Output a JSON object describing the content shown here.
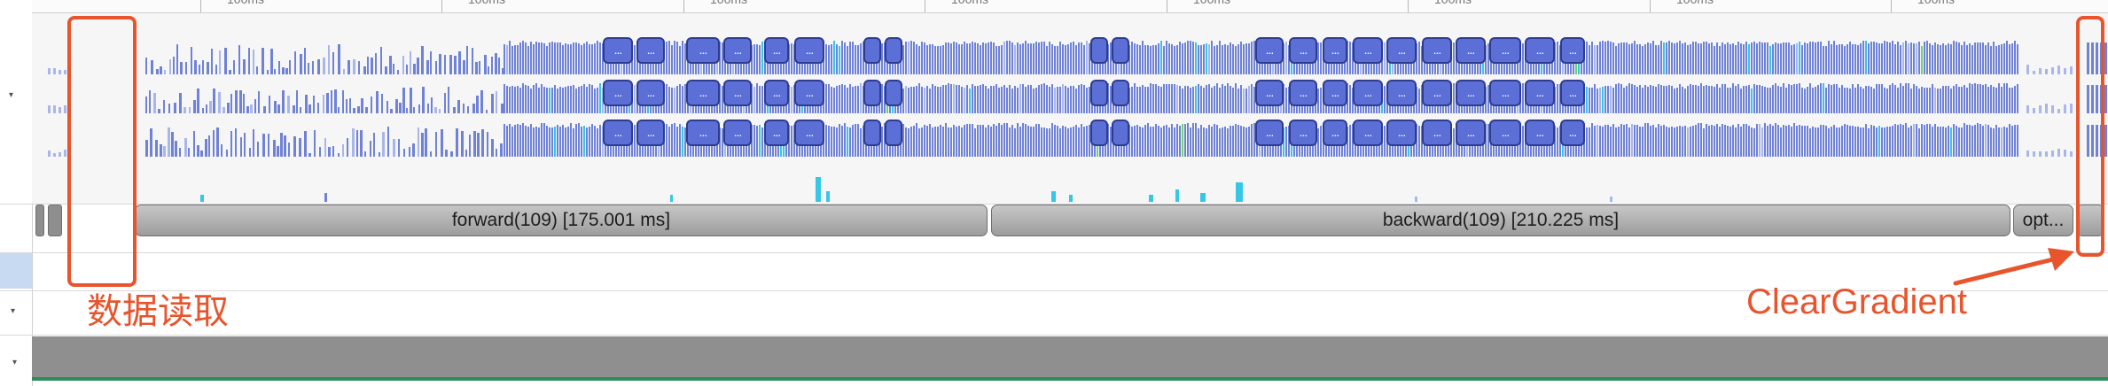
{
  "timeline": {
    "ruler_labels": [
      "100ms",
      "100ms",
      "100ms",
      "100ms",
      "100ms",
      "100ms",
      "100ms",
      "100ms"
    ],
    "expander_glyph": "▾",
    "cluster_glyph": "..."
  },
  "events": {
    "forward_label": "forward(109) [175.001 ms]",
    "backward_label": "backward(109) [210.225 ms]",
    "optimizer_label": "opt..."
  },
  "annotations": {
    "data_read_label": "数据读取",
    "clear_gradient_label": "ClearGradient"
  },
  "colors": {
    "accent": "#e8542c",
    "bar": "#6f82d6",
    "cyan": "#35c6e8",
    "event_fill": "#b4b4b4",
    "green": "#2e8b57"
  },
  "icons": {
    "expand": "chevron-down-icon",
    "arrow": "arrow-right-icon"
  }
}
